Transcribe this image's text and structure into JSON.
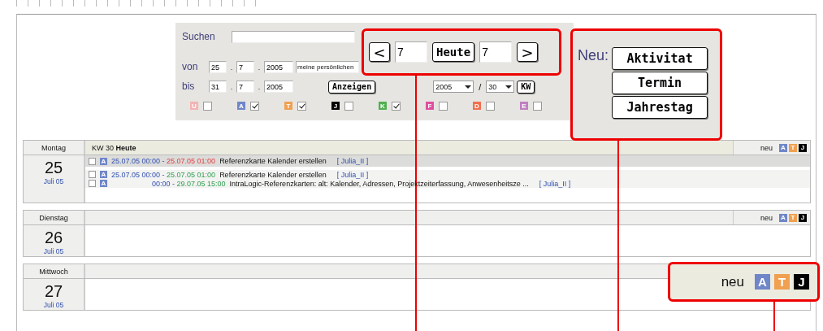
{
  "filter": {
    "search_label": "Suchen",
    "from_label": "von",
    "from_parts": [
      "25",
      "7",
      "2005"
    ],
    "owner_select": "meine persönlichen",
    "to_label": "bis",
    "to_parts": [
      "31",
      "7",
      "2005"
    ],
    "show_button": "Anzeigen",
    "year_select": "2005",
    "week_separator": "/",
    "week_select": "30",
    "week_button": "KW",
    "date_separator": ".",
    "categories": [
      {
        "letter": "U",
        "color": "#f4b4b4",
        "checked": false
      },
      {
        "letter": "A",
        "color": "#6f86c8",
        "checked": true
      },
      {
        "letter": "T",
        "color": "#f0a050",
        "checked": true
      },
      {
        "letter": "J",
        "color": "#000000",
        "checked": false
      },
      {
        "letter": "K",
        "color": "#50b050",
        "checked": true
      },
      {
        "letter": "F",
        "color": "#e050a0",
        "checked": false
      },
      {
        "letter": "D",
        "color": "#f07050",
        "checked": false
      },
      {
        "letter": "E",
        "color": "#c080c0",
        "checked": false
      }
    ]
  },
  "days": [
    {
      "weekday": "Montag",
      "day": "25",
      "month": "Juli 05",
      "week": "KW 30",
      "today": "Heute",
      "new_label": "neu",
      "tags": [
        {
          "letter": "A",
          "color": "#6f86c8"
        },
        {
          "letter": "T",
          "color": "#f0a050"
        },
        {
          "letter": "J",
          "color": "#000000"
        }
      ],
      "entries": [
        {
          "checked": false,
          "highlighted": true,
          "tag": "A",
          "start": "25.07.05 00:00 -",
          "end": "25.07.05 01:00",
          "kind": "late",
          "text": "Referenzkarte Kalender erstellen",
          "user": "[ Julia_II ]"
        },
        {
          "checked": false,
          "highlighted": false,
          "tag": "A",
          "start": "25.07.05 00:00 -",
          "end": "25.07.05 01:00",
          "kind": "open",
          "text": "Referenzkarte Kalender erstellen",
          "user": "[ Julia_II ]"
        },
        {
          "checked": false,
          "highlighted": false,
          "tag": "A",
          "start": "00:00 -",
          "end": "29.07.05 15:00",
          "kind": "open",
          "text": "IntraLogic-Referenzkarten: alt: Kalender, Adressen, Projektzeiterfassung, Anwesenheitsze ...",
          "user": "[ Julia_II ]"
        }
      ]
    },
    {
      "weekday": "Dienstag",
      "day": "26",
      "month": "Juli 05",
      "new_label": "neu",
      "tags": [
        {
          "letter": "A",
          "color": "#6f86c8"
        },
        {
          "letter": "T",
          "color": "#f0a050"
        },
        {
          "letter": "J",
          "color": "#000000"
        }
      ]
    },
    {
      "weekday": "Mittwoch",
      "day": "27",
      "month": "Juli 05"
    }
  ],
  "callouts": {
    "navigation": {
      "prev": "<",
      "from_value": "7",
      "today_button": "Heute",
      "to_value": "7",
      "next": ">"
    },
    "create": {
      "label": "Neu:",
      "buttons": [
        "Aktivitat",
        "Termin",
        "Jahrestag"
      ]
    },
    "legend": {
      "label": "neu",
      "tags": [
        {
          "letter": "A",
          "color": "#6f86c8"
        },
        {
          "letter": "T",
          "color": "#f0a050"
        },
        {
          "letter": "J",
          "color": "#000000"
        }
      ]
    }
  }
}
